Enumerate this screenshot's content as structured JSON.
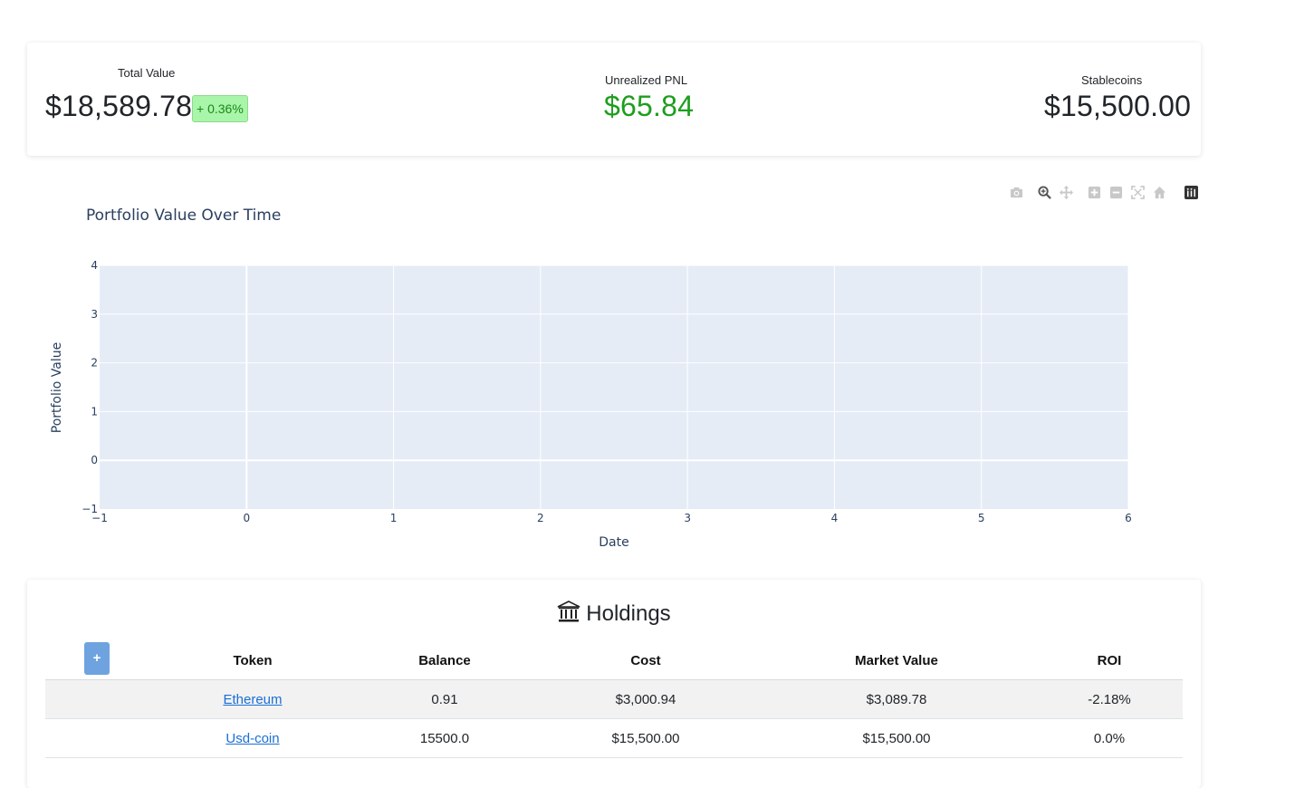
{
  "summary": {
    "total_value_label": "Total Value",
    "total_value": "$18,589.78",
    "total_change": "+ 0.36%",
    "pnl_label": "Unrealized PNL",
    "pnl_value": "$65.84",
    "stable_label": "Stablecoins",
    "stable_value": "$15,500.00",
    "pnl_color": "#1e9e1e"
  },
  "modebar": {
    "icons": [
      "camera-icon",
      "zoom-icon",
      "pan-icon",
      "zoom-in-icon",
      "zoom-out-icon",
      "autoscale-icon",
      "reset-axes-icon",
      "plotly-logo-icon"
    ]
  },
  "chart_data": {
    "type": "line",
    "title": "Portfolio Value Over Time",
    "xlabel": "Date",
    "ylabel": "Portfolio Value",
    "xlim": [
      -1,
      6
    ],
    "ylim": [
      -1,
      4
    ],
    "x_ticks": [
      "−1",
      "0",
      "1",
      "2",
      "3",
      "4",
      "5",
      "6"
    ],
    "y_ticks": [
      "−1",
      "0",
      "1",
      "2",
      "3",
      "4"
    ],
    "x": [],
    "values": [],
    "grid": true,
    "plot_bg": "#e5ecf6"
  },
  "holdings": {
    "title": "Holdings",
    "title_icon": "bank-icon",
    "add_label": "+",
    "columns": [
      "",
      "Token",
      "Balance",
      "Cost",
      "Market Value",
      "ROI"
    ],
    "rows": [
      {
        "token": "Ethereum",
        "balance": "0.91",
        "cost": "$3,000.94",
        "market_value": "$3,089.78",
        "roi": "-2.18%"
      },
      {
        "token": "Usd-coin",
        "balance": "15500.0",
        "cost": "$15,500.00",
        "market_value": "$15,500.00",
        "roi": "0.0%"
      }
    ]
  }
}
